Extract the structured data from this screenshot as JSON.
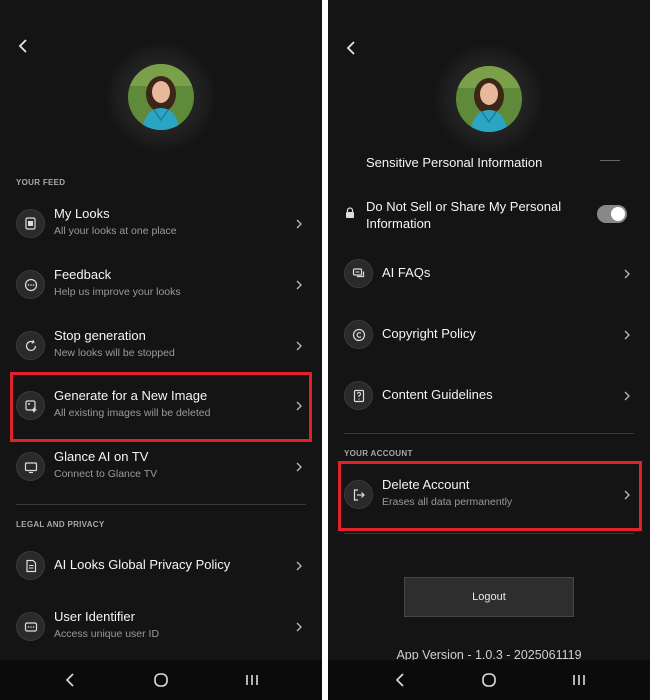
{
  "left": {
    "sections": {
      "your_feed": "YOUR FEED",
      "legal": "LEGAL AND PRIVACY"
    },
    "items": {
      "my_looks": {
        "title": "My Looks",
        "sub": "All your looks at one place",
        "icon": "photo-stack-icon"
      },
      "feedback": {
        "title": "Feedback",
        "sub": "Help us improve your looks",
        "icon": "chat-bubble-icon"
      },
      "stop_generation": {
        "title": "Stop generation",
        "sub": "New looks will be stopped",
        "icon": "refresh-icon"
      },
      "generate_new": {
        "title": "Generate for a New Image",
        "sub": "All existing images will be deleted",
        "icon": "image-sparkle-icon"
      },
      "glance_tv": {
        "title": "Glance AI on TV",
        "sub": "Connect to Glance TV",
        "icon": "tv-icon"
      },
      "privacy_policy": {
        "title": "AI Looks Global Privacy Policy",
        "icon": "document-icon"
      },
      "user_identifier": {
        "title": "User Identifier",
        "sub": "Access unique user ID",
        "icon": "id-card-icon"
      }
    }
  },
  "right": {
    "partial_item": "Sensitive Personal Information",
    "do_not_sell": "Do Not Sell or Share My Personal Information",
    "toggle_on": true,
    "items": {
      "ai_faqs": {
        "title": "AI FAQs",
        "icon": "chat-double-icon"
      },
      "copyright": {
        "title": "Copyright Policy",
        "icon": "copyright-icon"
      },
      "guidelines": {
        "title": "Content Guidelines",
        "icon": "help-doc-icon"
      },
      "delete_account": {
        "title": "Delete Account",
        "sub": "Erases all data permanently",
        "icon": "logout-arrow-icon"
      }
    },
    "your_account": "YOUR ACCOUNT",
    "logout_label": "Logout",
    "version": "App Version - 1.0.3 - 2025061119"
  },
  "colors": {
    "background": "#141414",
    "highlight": "#e0202a",
    "text": "#f5f5f5",
    "subtext": "#9a9a9a"
  }
}
